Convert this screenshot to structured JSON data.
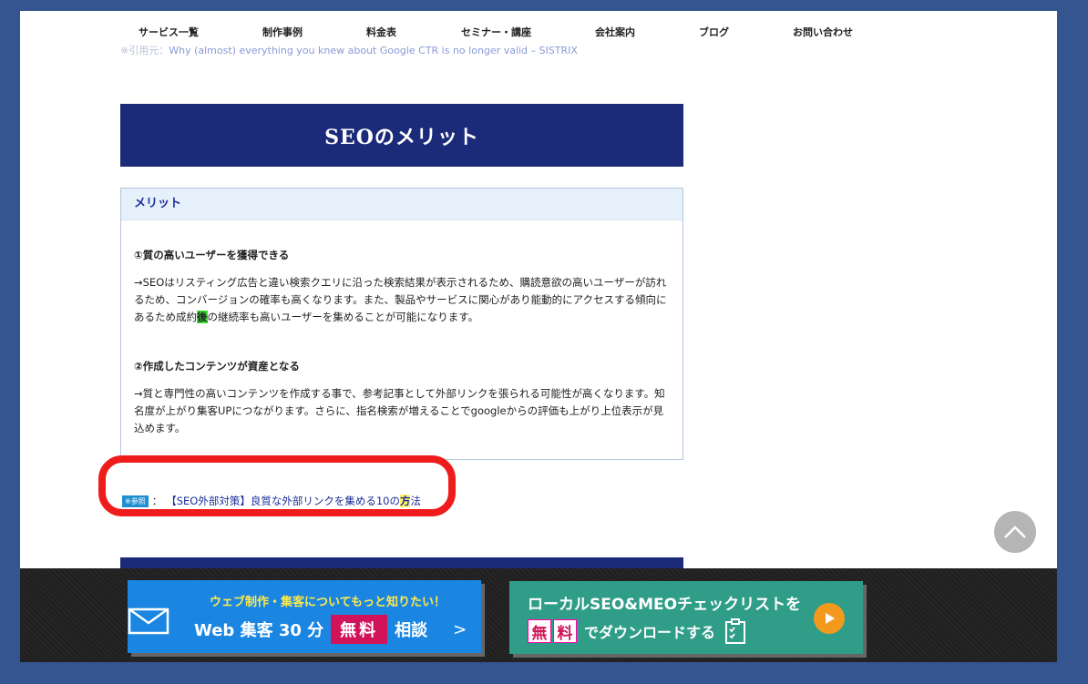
{
  "nav": {
    "items": [
      "サービス一覧",
      "制作事例",
      "料金表",
      "セミナー・講座",
      "会社案内",
      "ブログ",
      "お問い合わせ"
    ]
  },
  "source": {
    "prefix": "※引用元：",
    "link": "Why (almost) everything you knew about Google CTR is no longer valid – SISTRIX"
  },
  "section": {
    "title": "SEOのメリット"
  },
  "merit": {
    "heading": "メリット",
    "point1_title": "①質の高いユーザーを獲得できる",
    "point1_text_a": "→SEOはリスティング広告と違い検索クエリに沿った検索結果が表示されるため、購読意欲の高いユーザーが訪れるため、コンバージョンの確率も高くなります。また、製品やサービスに関心があり能動的にアクセスする傾向にあるため成約",
    "point1_text_hl": "後",
    "point1_text_b": "の継続率も高いユーザーを集めることが可能になります。",
    "point2_title": "②作成したコンテンツが資産となる",
    "point2_text": "→質と専門性の高いコンテンツを作成する事で、参考記事として外部リンクを張られる可能性が高くなります。知名度が上がり集客UPにつながります。さらに、指名検索が増えることでgoogleからの評価も上がり上位表示が見込めます。"
  },
  "reference": {
    "badge": "※参照",
    "colon": "：",
    "link_a": "【SEO外部対策】良質な外部リンクを集める10の",
    "link_hl": "方",
    "link_b": "法"
  },
  "cta_consult": {
    "top_text": "ウェブ制作・集客についてもっと知りたい！",
    "main_text": "Web 集客 30 分",
    "free_badge": "無料",
    "consult_text": "相談",
    "arrow": ">"
  },
  "cta_download": {
    "line1": "ローカルSEO&MEOチェックリストを",
    "char1": "無",
    "char2": "料",
    "line2": "でダウンロードする"
  },
  "colors": {
    "frame": "#34558f",
    "banner": "#1c2a7a",
    "cta_blue": "#1a86e2",
    "cta_green": "#2f9d88",
    "highlight_red": "#ef1c1c"
  }
}
